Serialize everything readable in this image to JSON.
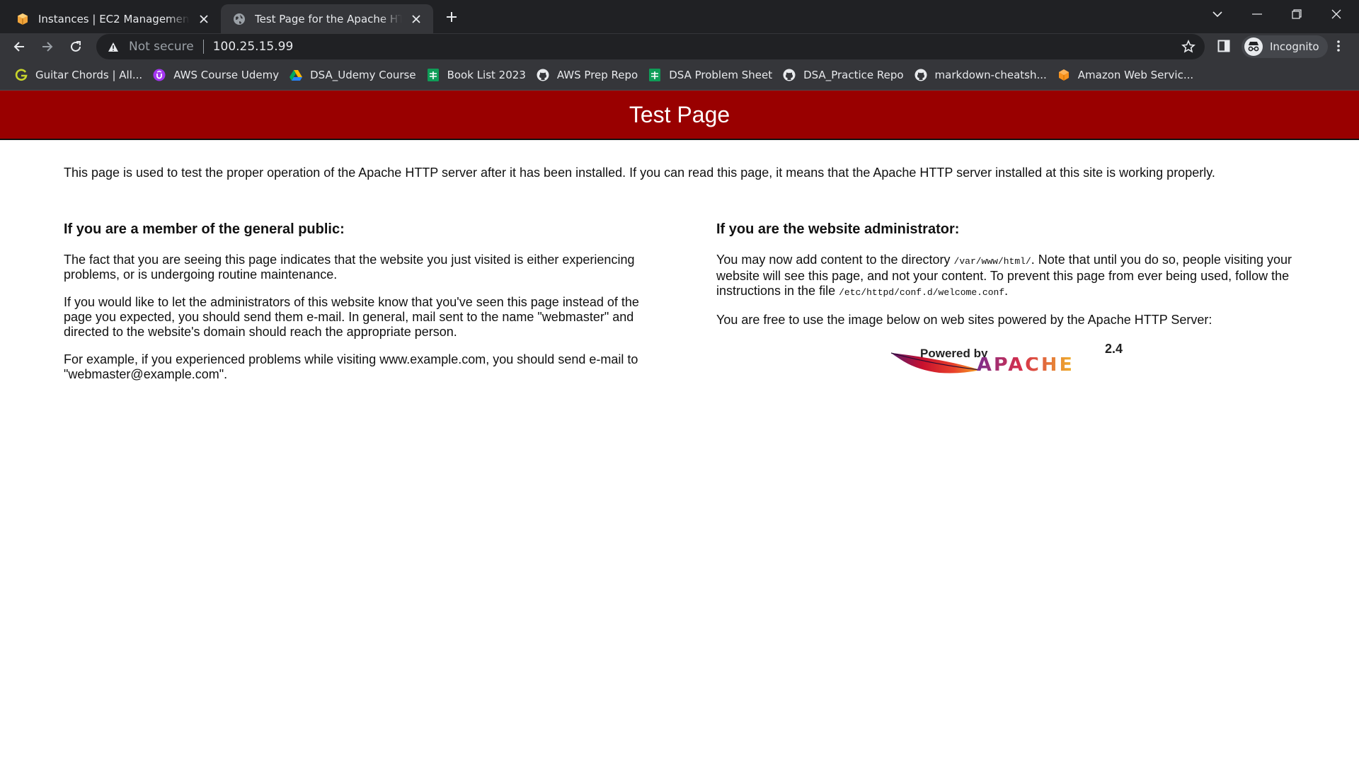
{
  "browser": {
    "tabs": [
      {
        "title": "Instances | EC2 Management Console",
        "active": false,
        "icon": "aws-box-icon"
      },
      {
        "title": "Test Page for the Apache HTTP Server",
        "active": true,
        "icon": "globe-icon"
      }
    ],
    "address": {
      "security_label": "Not secure",
      "url": "100.25.15.99"
    },
    "profile_label": "Incognito",
    "bookmarks": [
      {
        "label": "Guitar Chords | All...",
        "icon": "g-logo-icon"
      },
      {
        "label": "AWS Course Udemy",
        "icon": "udemy-icon"
      },
      {
        "label": "DSA_Udemy Course",
        "icon": "drive-icon"
      },
      {
        "label": "Book List 2023",
        "icon": "sheets-icon"
      },
      {
        "label": "AWS Prep Repo",
        "icon": "github-icon"
      },
      {
        "label": "DSA Problem Sheet",
        "icon": "sheets-icon"
      },
      {
        "label": "DSA_Practice Repo",
        "icon": "github-icon"
      },
      {
        "label": "markdown-cheatsh...",
        "icon": "github-icon"
      },
      {
        "label": "Amazon Web Servic...",
        "icon": "aws-cube-icon"
      }
    ]
  },
  "page": {
    "banner_title": "Test Page",
    "intro": "This page is used to test the proper operation of the Apache HTTP server after it has been installed. If you can read this page, it means that the Apache HTTP server installed at this site is working properly.",
    "public": {
      "heading": "If you are a member of the general public:",
      "p1": "The fact that you are seeing this page indicates that the website you just visited is either experiencing problems, or is undergoing routine maintenance.",
      "p2": "If you would like to let the administrators of this website know that you've seen this page instead of the page you expected, you should send them e-mail. In general, mail sent to the name \"webmaster\" and directed to the website's domain should reach the appropriate person.",
      "p3": "For example, if you experienced problems while visiting www.example.com, you should send e-mail to \"webmaster@example.com\"."
    },
    "admin": {
      "heading": "If you are the website administrator:",
      "p1_a": "You may now add content to the directory ",
      "p1_dir": "/var/www/html/",
      "p1_b": ". Note that until you do so, people visiting your website will see this page, and not your content. To prevent this page from ever being used, follow the instructions in the file ",
      "p1_file": "/etc/httpd/conf.d/welcome.conf",
      "p1_c": ".",
      "p2": "You are free to use the image below on web sites powered by the Apache HTTP Server:",
      "badge_powered": "Powered by",
      "badge_version": "2.4",
      "badge_apache": "APACHE"
    }
  },
  "colors": {
    "banner": "#990000",
    "chrome_dark": "#202124",
    "chrome_mid": "#35363a"
  }
}
